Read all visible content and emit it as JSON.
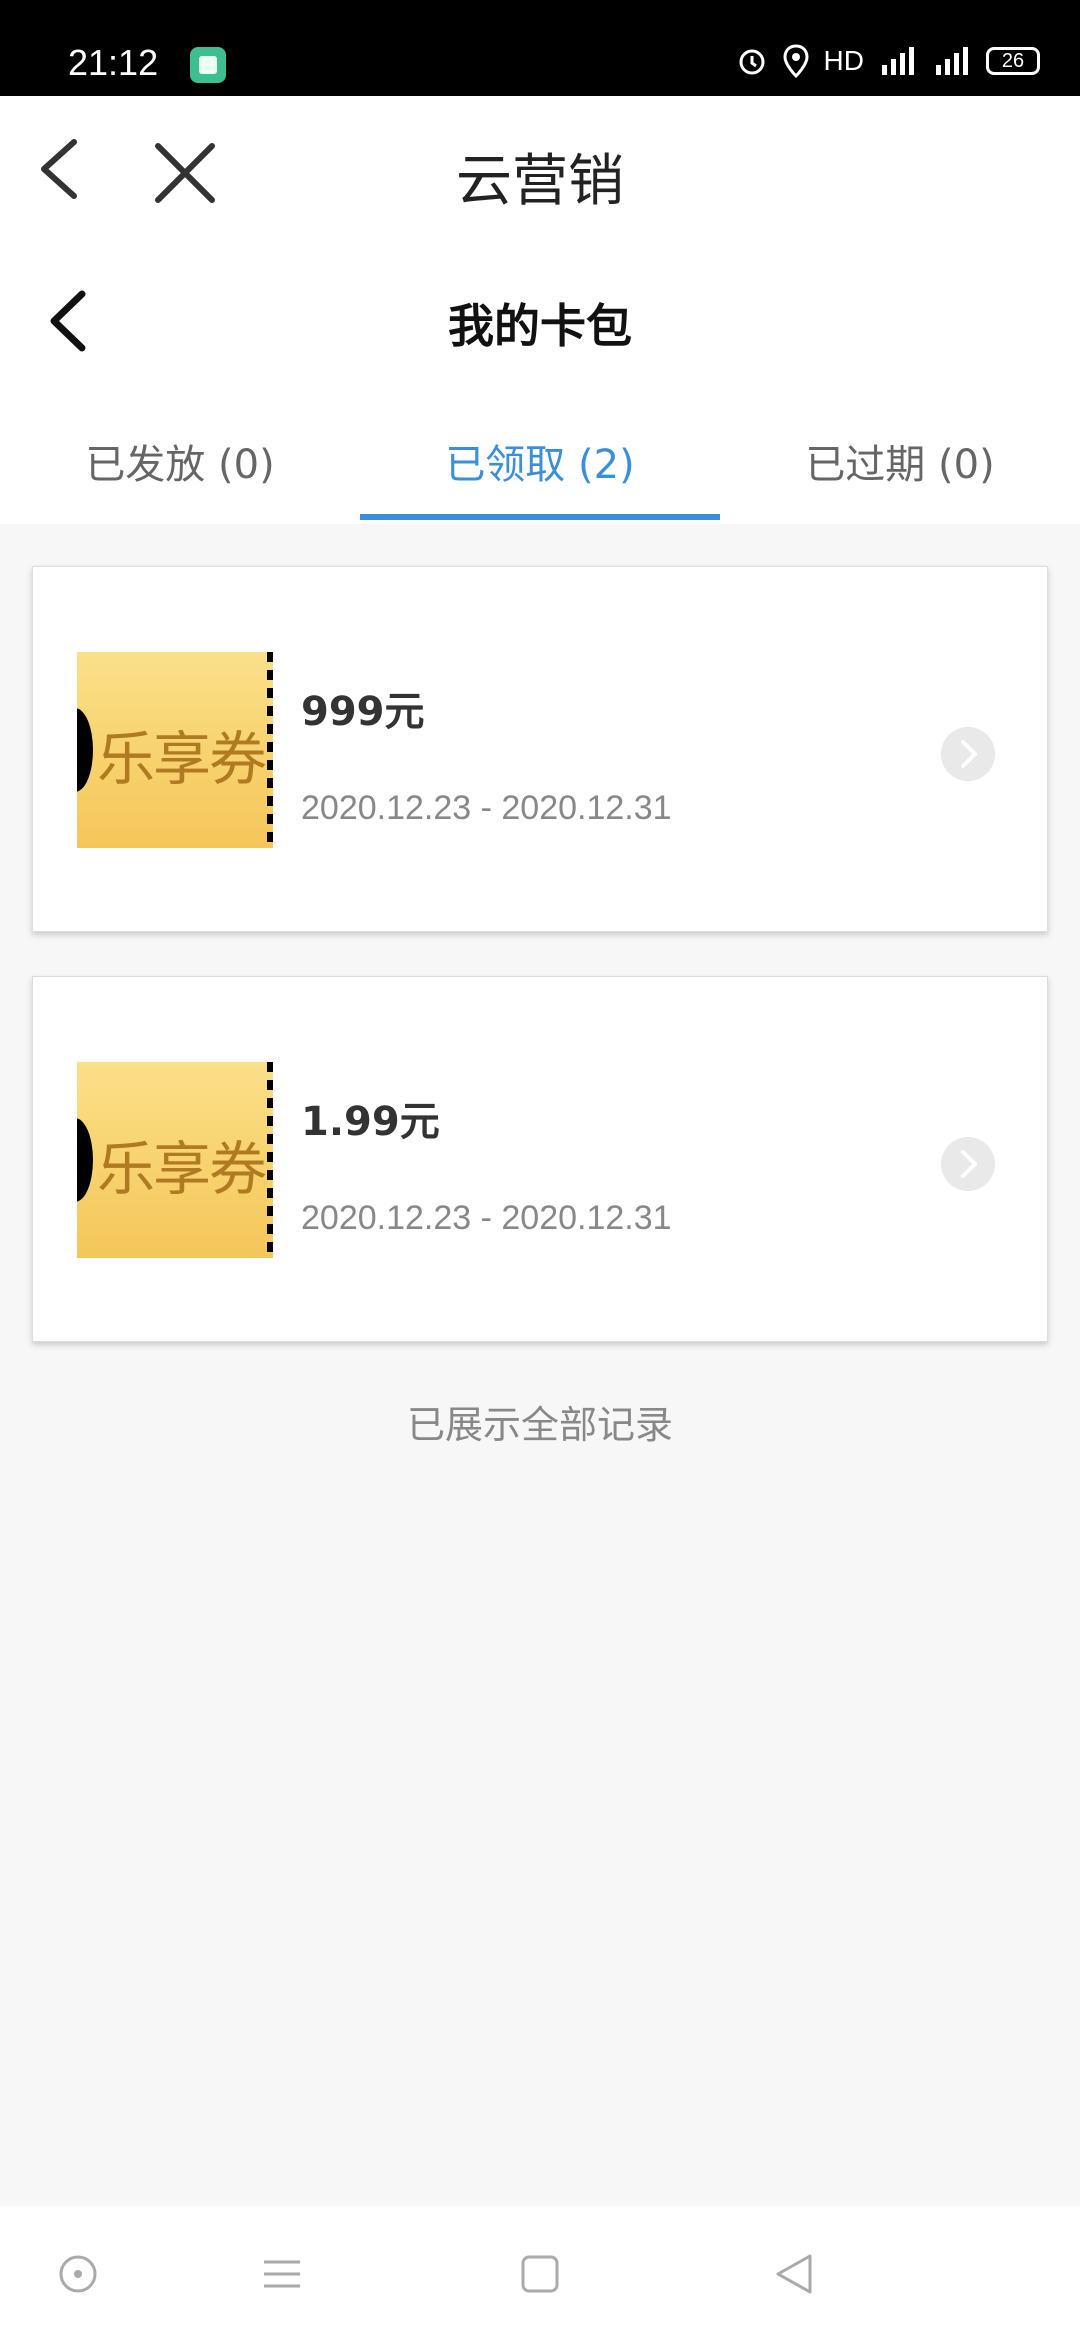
{
  "status_bar": {
    "time": "21:12",
    "hd_label": "HD",
    "net1": "4G",
    "net2": "4G",
    "battery": "26"
  },
  "nav": {
    "title": "云营销",
    "back_icon": "chevron-left-icon",
    "close_icon": "close-icon"
  },
  "page": {
    "title": "我的卡包"
  },
  "tabs": [
    {
      "label": "已发放 (0)",
      "active": false
    },
    {
      "label": "已领取 (2)",
      "active": true
    },
    {
      "label": "已过期 (0)",
      "active": false
    }
  ],
  "coupons": [
    {
      "image_text": "乐享券",
      "amount": "999元",
      "date_range": "2020.12.23 - 2020.12.31"
    },
    {
      "image_text": "乐享券",
      "amount": "1.99元",
      "date_range": "2020.12.23 - 2020.12.31"
    }
  ],
  "footer_note": "已展示全部记录",
  "colors": {
    "accent": "#3a8fd8",
    "background": "#f7f7f7",
    "coupon_gold": "#f7d26d"
  }
}
